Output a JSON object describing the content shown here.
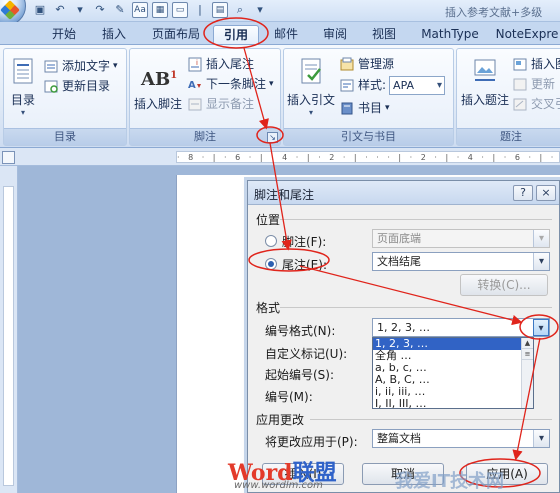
{
  "window": {
    "title": "插入参考文献+多级"
  },
  "qat": {
    "undo_icon": "undo-icon",
    "redo_icon": "redo-icon"
  },
  "tabs": [
    {
      "label": "开始",
      "active": false
    },
    {
      "label": "插入",
      "active": false
    },
    {
      "label": "页面布局",
      "active": false
    },
    {
      "label": "引用",
      "active": true
    },
    {
      "label": "邮件",
      "active": false
    },
    {
      "label": "审阅",
      "active": false
    },
    {
      "label": "视图",
      "active": false
    },
    {
      "label": "MathType",
      "active": false
    },
    {
      "label": "NoteExpre",
      "active": false
    }
  ],
  "ribbon": {
    "toc": {
      "group_label": "目录",
      "toc_button": "目录",
      "add_text": "添加文字",
      "update_toc": "更新目录"
    },
    "footnotes": {
      "group_label": "脚注",
      "insert_footnote": "插入脚注",
      "insert_endnote": "插入尾注",
      "next_footnote": "下一条脚注",
      "show_notes": "显示备注",
      "ab_label": "AB"
    },
    "citations": {
      "group_label": "引文与书目",
      "insert_citation": "插入引文",
      "manage_sources": "管理源",
      "style_label": "样式:",
      "style_value": "APA",
      "bibliography": "书目"
    },
    "captions": {
      "group_label": "题注",
      "insert_caption": "插入题注",
      "insert_table_of_figures": "插入图",
      "update_table": "更新",
      "cross_reference": "交叉引"
    }
  },
  "dialog": {
    "title": "脚注和尾注",
    "help": "?",
    "close": "×",
    "location_section": "位置",
    "footnote_label": "脚注(F):",
    "footnote_value": "页面底端",
    "endnote_label": "尾注(E):",
    "endnote_value": "文档结尾",
    "convert_button": "转换(C)...",
    "format_section": "格式",
    "number_format_label": "编号格式(N):",
    "number_format_value": "1, 2, 3, …",
    "custom_mark_label": "自定义标记(U):",
    "start_at_label": "起始编号(S):",
    "numbering_label": "编号(M):",
    "apply_changes_section": "应用更改",
    "apply_to_label": "将更改应用于(P):",
    "apply_to_value": "整篇文档",
    "insert_button": "插入(I)",
    "cancel_button": "取消",
    "apply_button": "应用(A)",
    "number_format_options": [
      "1, 2, 3, …",
      "全角 …",
      "a, b, c, …",
      "A, B, C, …",
      "i, ii, iii, …",
      "I, II, III, …"
    ]
  },
  "watermark": {
    "logo_word": "Word",
    "logo_cn": "联盟",
    "url": "www.wordlm.com",
    "cn_site": "我爱IT技术网"
  },
  "colors": {
    "annotation": "#e0241b",
    "accent": "#2f62c9"
  }
}
